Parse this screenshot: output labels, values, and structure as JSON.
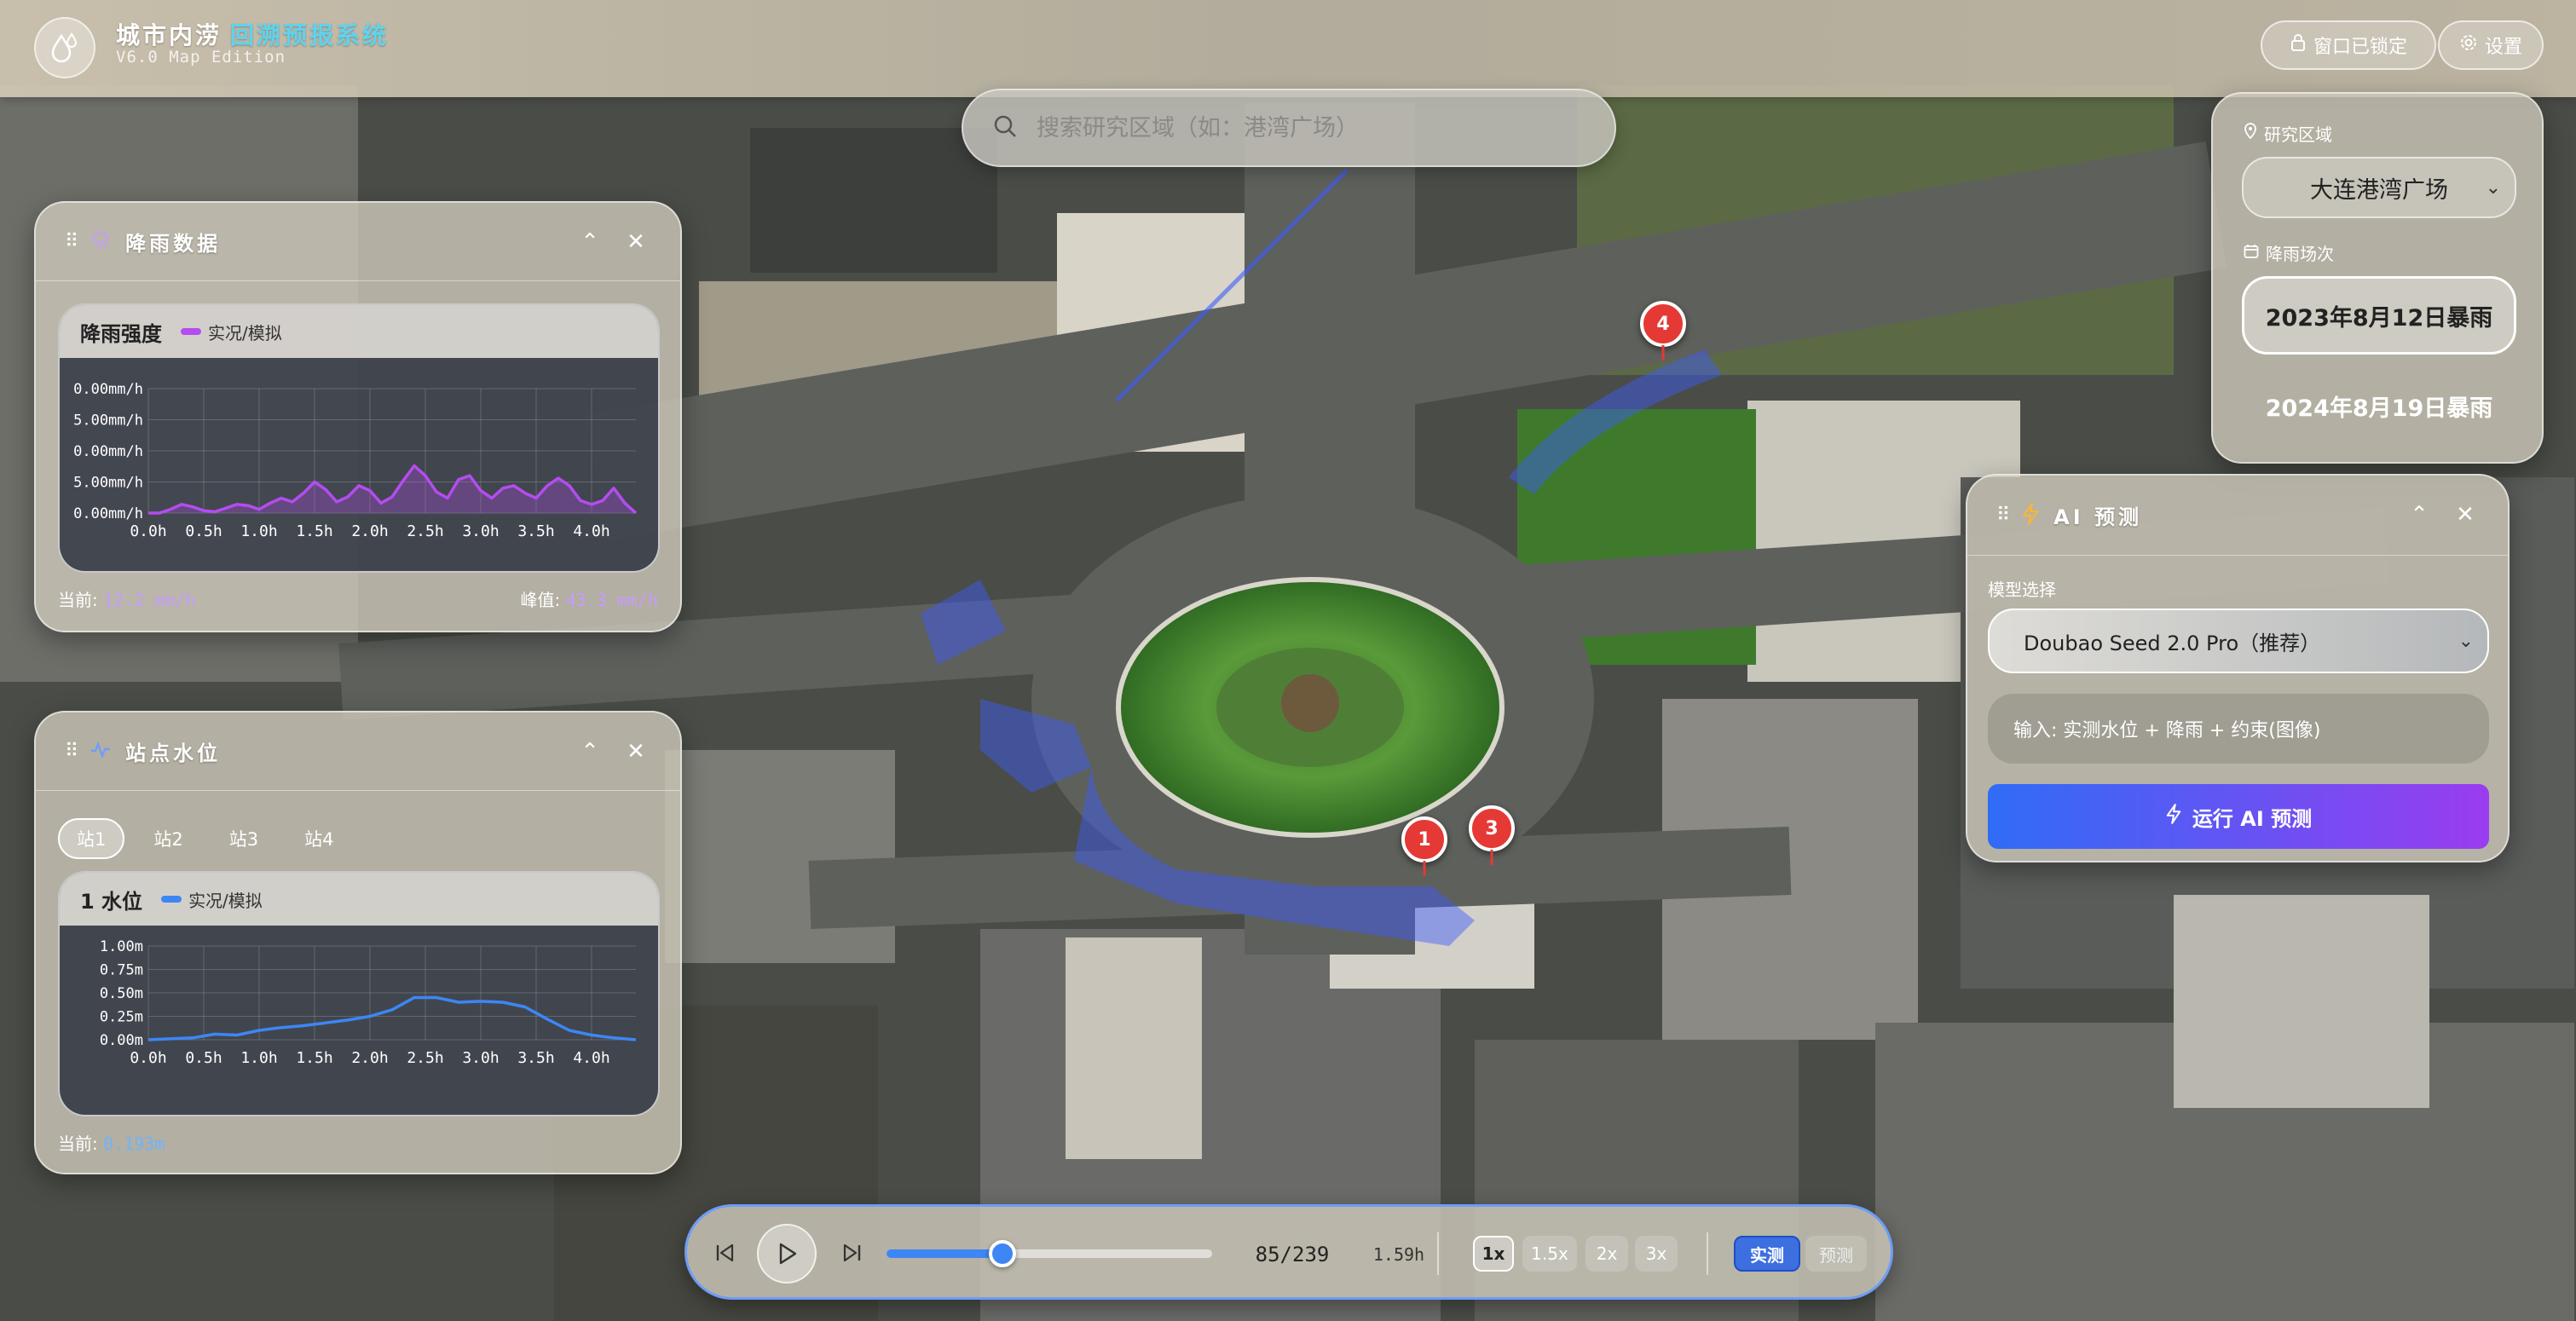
{
  "app": {
    "title_main": "城市内涝",
    "title_accent": "回溯预报系统",
    "subtitle": "V6.0 Map Edition",
    "lock_label": "窗口已锁定",
    "settings_label": "设置"
  },
  "search": {
    "placeholder": "搜索研究区域（如：港湾广场）"
  },
  "colors": {
    "rain_series": "#b44cf0",
    "water_series": "#3d86f5",
    "marker": "#e53935",
    "run_button_from": "#2f6cf6",
    "run_button_to": "#9a3cf0"
  },
  "rain_panel": {
    "title": "降雨数据",
    "chart_title": "降雨强度",
    "legend": "实况/模拟",
    "current_label": "当前:",
    "current_value": "12.2 mm/h",
    "peak_label": "峰值:",
    "peak_value": "43.3 mm/h"
  },
  "station_panel": {
    "title": "站点水位",
    "tabs": [
      "站1",
      "站2",
      "站3",
      "站4"
    ],
    "active_tab": "站1",
    "chart_title": "1 水位",
    "legend": "实况/模拟",
    "current_label": "当前:",
    "current_value": "0.193m"
  },
  "region_panel": {
    "region_label": "研究区域",
    "region_value": "大连港湾广场",
    "event_label": "降雨场次",
    "events": [
      "2023年8月12日暴雨",
      "2024年8月19日暴雨"
    ],
    "selected_event": "2023年8月12日暴雨"
  },
  "ai_panel": {
    "title": "AI 预测",
    "model_label": "模型选择",
    "model_value": "Doubao Seed 2.0 Pro（推荐）",
    "input_text": "输入: 实测水位 + 降雨 + 约束(图像)",
    "run_label": "运行 AI 预测"
  },
  "timeline": {
    "frame": "85/239",
    "time": "1.59h",
    "progress": 0.355,
    "speeds": [
      "1x",
      "1.5x",
      "2x",
      "3x"
    ],
    "active_speed": "1x",
    "mode_measured": "实测",
    "mode_forecast": "预测",
    "active_mode": "实测"
  },
  "markers": [
    "1",
    "3",
    "4"
  ],
  "chart_data": [
    {
      "type": "area",
      "title": "降雨强度",
      "series": [
        {
          "name": "实况/模拟",
          "x": [
            0,
            0.1,
            0.2,
            0.3,
            0.4,
            0.5,
            0.6,
            0.7,
            0.8,
            0.9,
            1.0,
            1.1,
            1.2,
            1.3,
            1.4,
            1.5,
            1.6,
            1.7,
            1.8,
            1.9,
            2.0,
            2.1,
            2.2,
            2.3,
            2.4,
            2.5,
            2.6,
            2.7,
            2.8,
            2.9,
            3.0,
            3.1,
            3.2,
            3.3,
            3.4,
            3.5,
            3.6,
            3.7,
            3.8,
            3.9,
            4.0,
            4.1,
            4.2,
            4.3,
            4.4
          ],
          "values": [
            0,
            0,
            3,
            7,
            5,
            2,
            1,
            4,
            7,
            6,
            3,
            8,
            12,
            9,
            16,
            25,
            19,
            9,
            13,
            22,
            18,
            8,
            13,
            26,
            38,
            30,
            17,
            12,
            27,
            30,
            18,
            12,
            20,
            22,
            16,
            12,
            22,
            28,
            22,
            10,
            7,
            10,
            20,
            8,
            0
          ]
        }
      ],
      "x_ticks": [
        "0.0h",
        "0.5h",
        "1.0h",
        "1.5h",
        "2.0h",
        "2.5h",
        "3.0h",
        "3.5h",
        "4.0h"
      ],
      "y_ticks": [
        "0.00mm/h",
        "5.00mm/h",
        "0.00mm/h",
        "5.00mm/h",
        "0.00mm/h"
      ],
      "ylim": [
        0,
        100
      ]
    },
    {
      "type": "line",
      "title": "1 水位",
      "series": [
        {
          "name": "实况/模拟",
          "x": [
            0,
            0.2,
            0.4,
            0.6,
            0.8,
            1.0,
            1.2,
            1.4,
            1.6,
            1.8,
            2.0,
            2.2,
            2.4,
            2.6,
            2.8,
            3.0,
            3.2,
            3.4,
            3.6,
            3.8,
            4.0,
            4.2,
            4.4
          ],
          "values": [
            0,
            0.01,
            0.02,
            0.06,
            0.05,
            0.1,
            0.13,
            0.15,
            0.18,
            0.21,
            0.25,
            0.32,
            0.45,
            0.45,
            0.4,
            0.41,
            0.4,
            0.35,
            0.22,
            0.1,
            0.05,
            0.02,
            0
          ]
        }
      ],
      "x_ticks": [
        "0.0h",
        "0.5h",
        "1.0h",
        "1.5h",
        "2.0h",
        "2.5h",
        "3.0h",
        "3.5h",
        "4.0h"
      ],
      "y_ticks": [
        "1.00m",
        "0.75m",
        "0.50m",
        "0.25m",
        "0.00m"
      ],
      "ylim": [
        0,
        1
      ]
    }
  ]
}
